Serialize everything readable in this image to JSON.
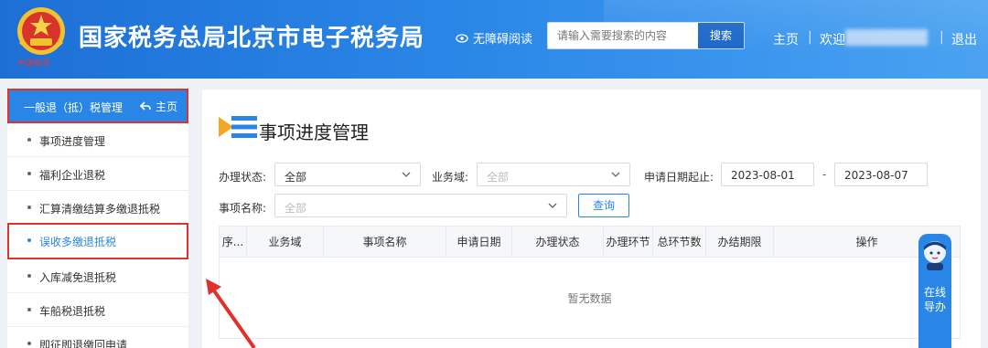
{
  "header": {
    "site_title": "国家税务总局北京市电子税务局",
    "emblem_text": "中国税务",
    "accessibility_label": "无障碍阅读",
    "search": {
      "placeholder": "请输入需要搜索的内容",
      "button_label": "搜索"
    },
    "nav": {
      "home": "主页",
      "separator": "|",
      "welcome": "欢迎",
      "logout": "退出"
    }
  },
  "sidebar": {
    "header_title": "一般退（抵）税管理",
    "home_label": "主页",
    "items": [
      {
        "label": "事项进度管理",
        "active": false
      },
      {
        "label": "福利企业退税",
        "active": false
      },
      {
        "label": "汇算清缴结算多缴退抵税",
        "active": false
      },
      {
        "label": "误收多缴退抵税",
        "active": true
      },
      {
        "label": "入库减免退抵税",
        "active": false
      },
      {
        "label": "车船税退抵税",
        "active": false
      },
      {
        "label": "即征即退缴回申请",
        "active": false
      }
    ]
  },
  "main": {
    "page_title": "事项进度管理",
    "filters": {
      "status_label": "办理状态:",
      "status_value": "全部",
      "domain_label": "业务域:",
      "domain_value": "全部",
      "date_label": "申请日期起止:",
      "date_from": "2023-08-01",
      "date_sep": "-",
      "date_to": "2023-08-07",
      "item_name_label": "事项名称:",
      "item_name_value": "全部",
      "query_button": "查询"
    },
    "table": {
      "columns": [
        "序...",
        "业务域",
        "事项名称",
        "申请日期",
        "办理状态",
        "办理环节",
        "总环节数",
        "办结期限",
        "操作"
      ],
      "empty_text": "暂无数据"
    }
  },
  "guide_widget": {
    "label": "在线导办"
  },
  "colors": {
    "header_blue": "#2a86e6",
    "highlight_red": "#e0322b",
    "search_button": "#1b67c9"
  }
}
